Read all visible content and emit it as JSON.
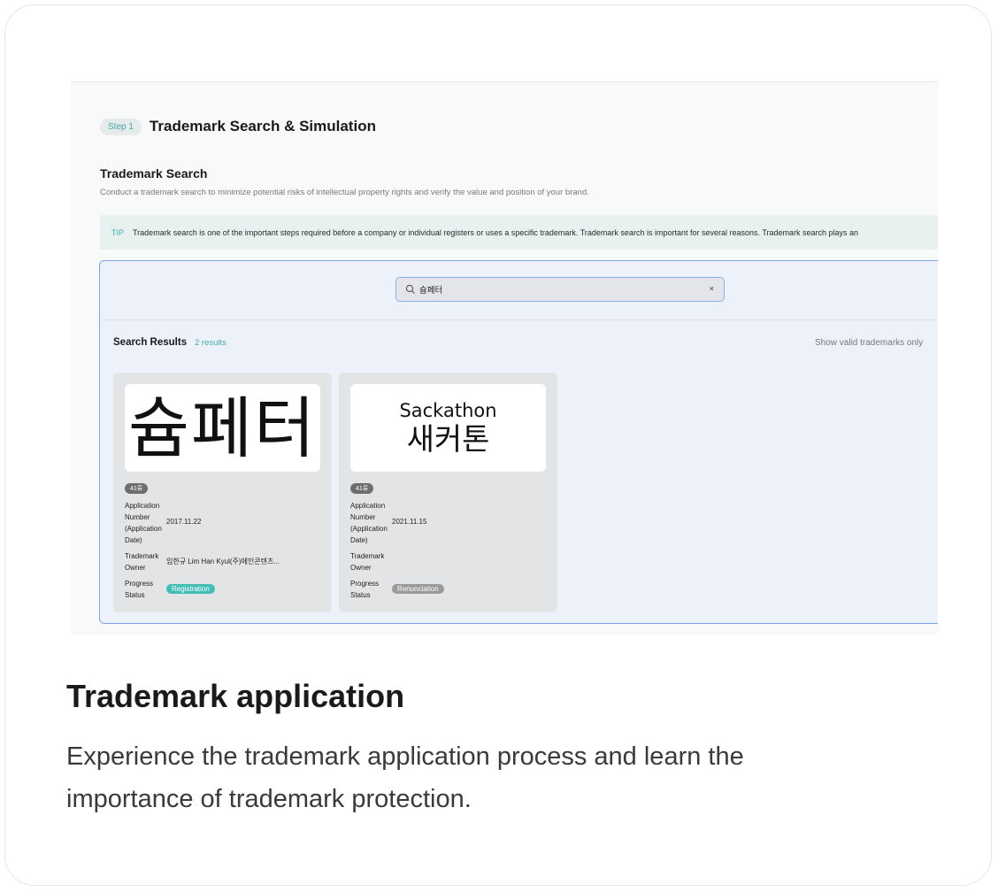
{
  "step": {
    "badge": "Step 1",
    "title": "Trademark Search & Simulation"
  },
  "section": {
    "title": "Trademark Search",
    "description": "Conduct a trademark search to minimize potential risks of intellectual property rights and verify the value and position of your brand."
  },
  "tip": {
    "tag": "TIP",
    "text": "Trademark search is one of the important steps required before a company or individual registers or uses a specific trademark. Trademark search is important for several reasons. Trademark search plays an"
  },
  "search": {
    "value": "슘페터",
    "clear_label": "×"
  },
  "results": {
    "label": "Search Results",
    "count": "2 results",
    "valid_toggle": "Show valid trademarks only",
    "labels": {
      "application": [
        "Application",
        "Number",
        "(Application",
        "Date)"
      ],
      "owner": [
        "Trademark",
        "Owner"
      ],
      "status": [
        "Progress",
        "Status"
      ]
    },
    "items": [
      {
        "mark_text": "슘페터",
        "class_badge": "41류",
        "application_value": "2017.11.22",
        "owner_value": "임한규 Lim Han Kyul(주)메인콘텐츠...",
        "status": "Registration",
        "status_color": "#45bdb7"
      },
      {
        "mark_line1": "Sackathon",
        "mark_line2": "새커톤",
        "class_badge": "41류",
        "application_value": "2021.11.15",
        "owner_value": "",
        "status": "Renunciation",
        "status_color": "#9a9a9a"
      }
    ]
  },
  "caption": {
    "title": "Trademark application",
    "description": "Experience the trademark application process and learn the importance of trademark protection."
  }
}
